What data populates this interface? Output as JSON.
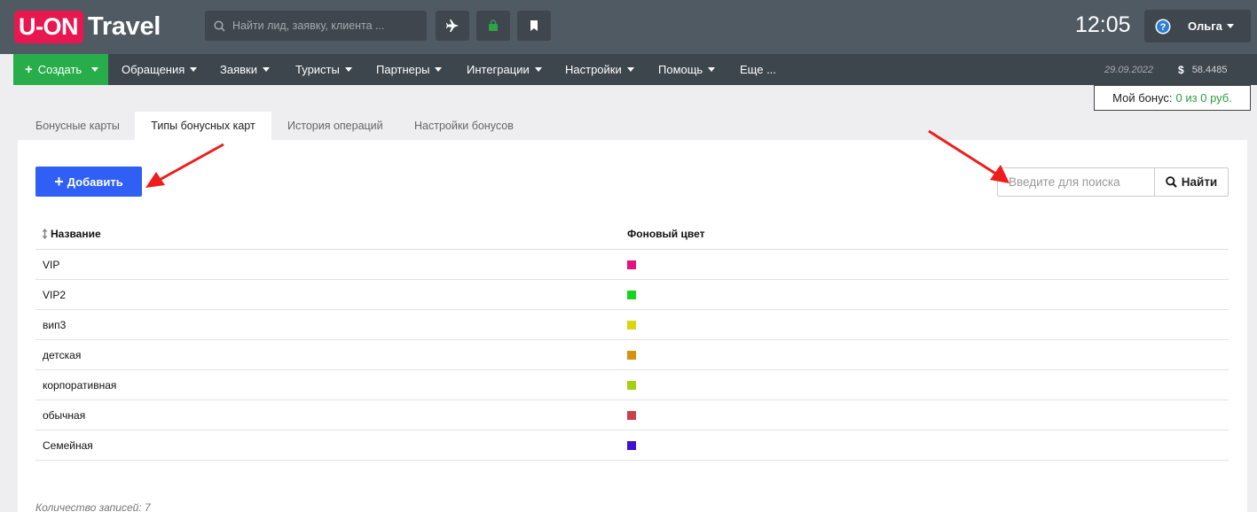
{
  "header": {
    "logo_left": "U-ON",
    "logo_right": "Travel",
    "search_placeholder": "Найти лид, заявку, клиента ...",
    "clock": "12:05",
    "user_name": "Ольга",
    "quick_buttons": [
      "plane-icon",
      "bag-icon",
      "bookmark-icon"
    ]
  },
  "nav": {
    "create_label": "Создать",
    "items": [
      "Обращения",
      "Заявки",
      "Туристы",
      "Партнеры",
      "Интеграции",
      "Настройки",
      "Помощь",
      "Еще ..."
    ],
    "date": "29.09.2022",
    "currency_symbol": "$",
    "balance": "58.4485"
  },
  "bonus": {
    "label": "Мой бонус:",
    "value": "0 из 0 руб."
  },
  "tabs": [
    {
      "label": "Бонусные карты",
      "active": false
    },
    {
      "label": "Типы бонусных карт",
      "active": true
    },
    {
      "label": "История операций",
      "active": false
    },
    {
      "label": "Настройки бонусов",
      "active": false
    }
  ],
  "toolbar": {
    "add_label": "Добавить",
    "search_placeholder": "Введите для поиска",
    "find_label": "Найти"
  },
  "table": {
    "columns": [
      "Название",
      "Фоновый цвет"
    ],
    "rows": [
      {
        "name": "VIP",
        "color": "#e2157a"
      },
      {
        "name": "VIP2",
        "color": "#19d41f"
      },
      {
        "name": "вип3",
        "color": "#d8d80c"
      },
      {
        "name": "детская",
        "color": "#d99110"
      },
      {
        "name": "корпоративная",
        "color": "#a6cf12"
      },
      {
        "name": "обычная",
        "color": "#c9414a"
      },
      {
        "name": "Семейная",
        "color": "#3c14cf"
      }
    ]
  },
  "footer": {
    "count_text": "Количество записей: 7"
  },
  "colors": {
    "brand": "#e8174f",
    "create": "#27ae4a",
    "primary": "#2f5ff5",
    "topbar": "#505a63",
    "annotation_arrow": "#ee1c1c"
  }
}
